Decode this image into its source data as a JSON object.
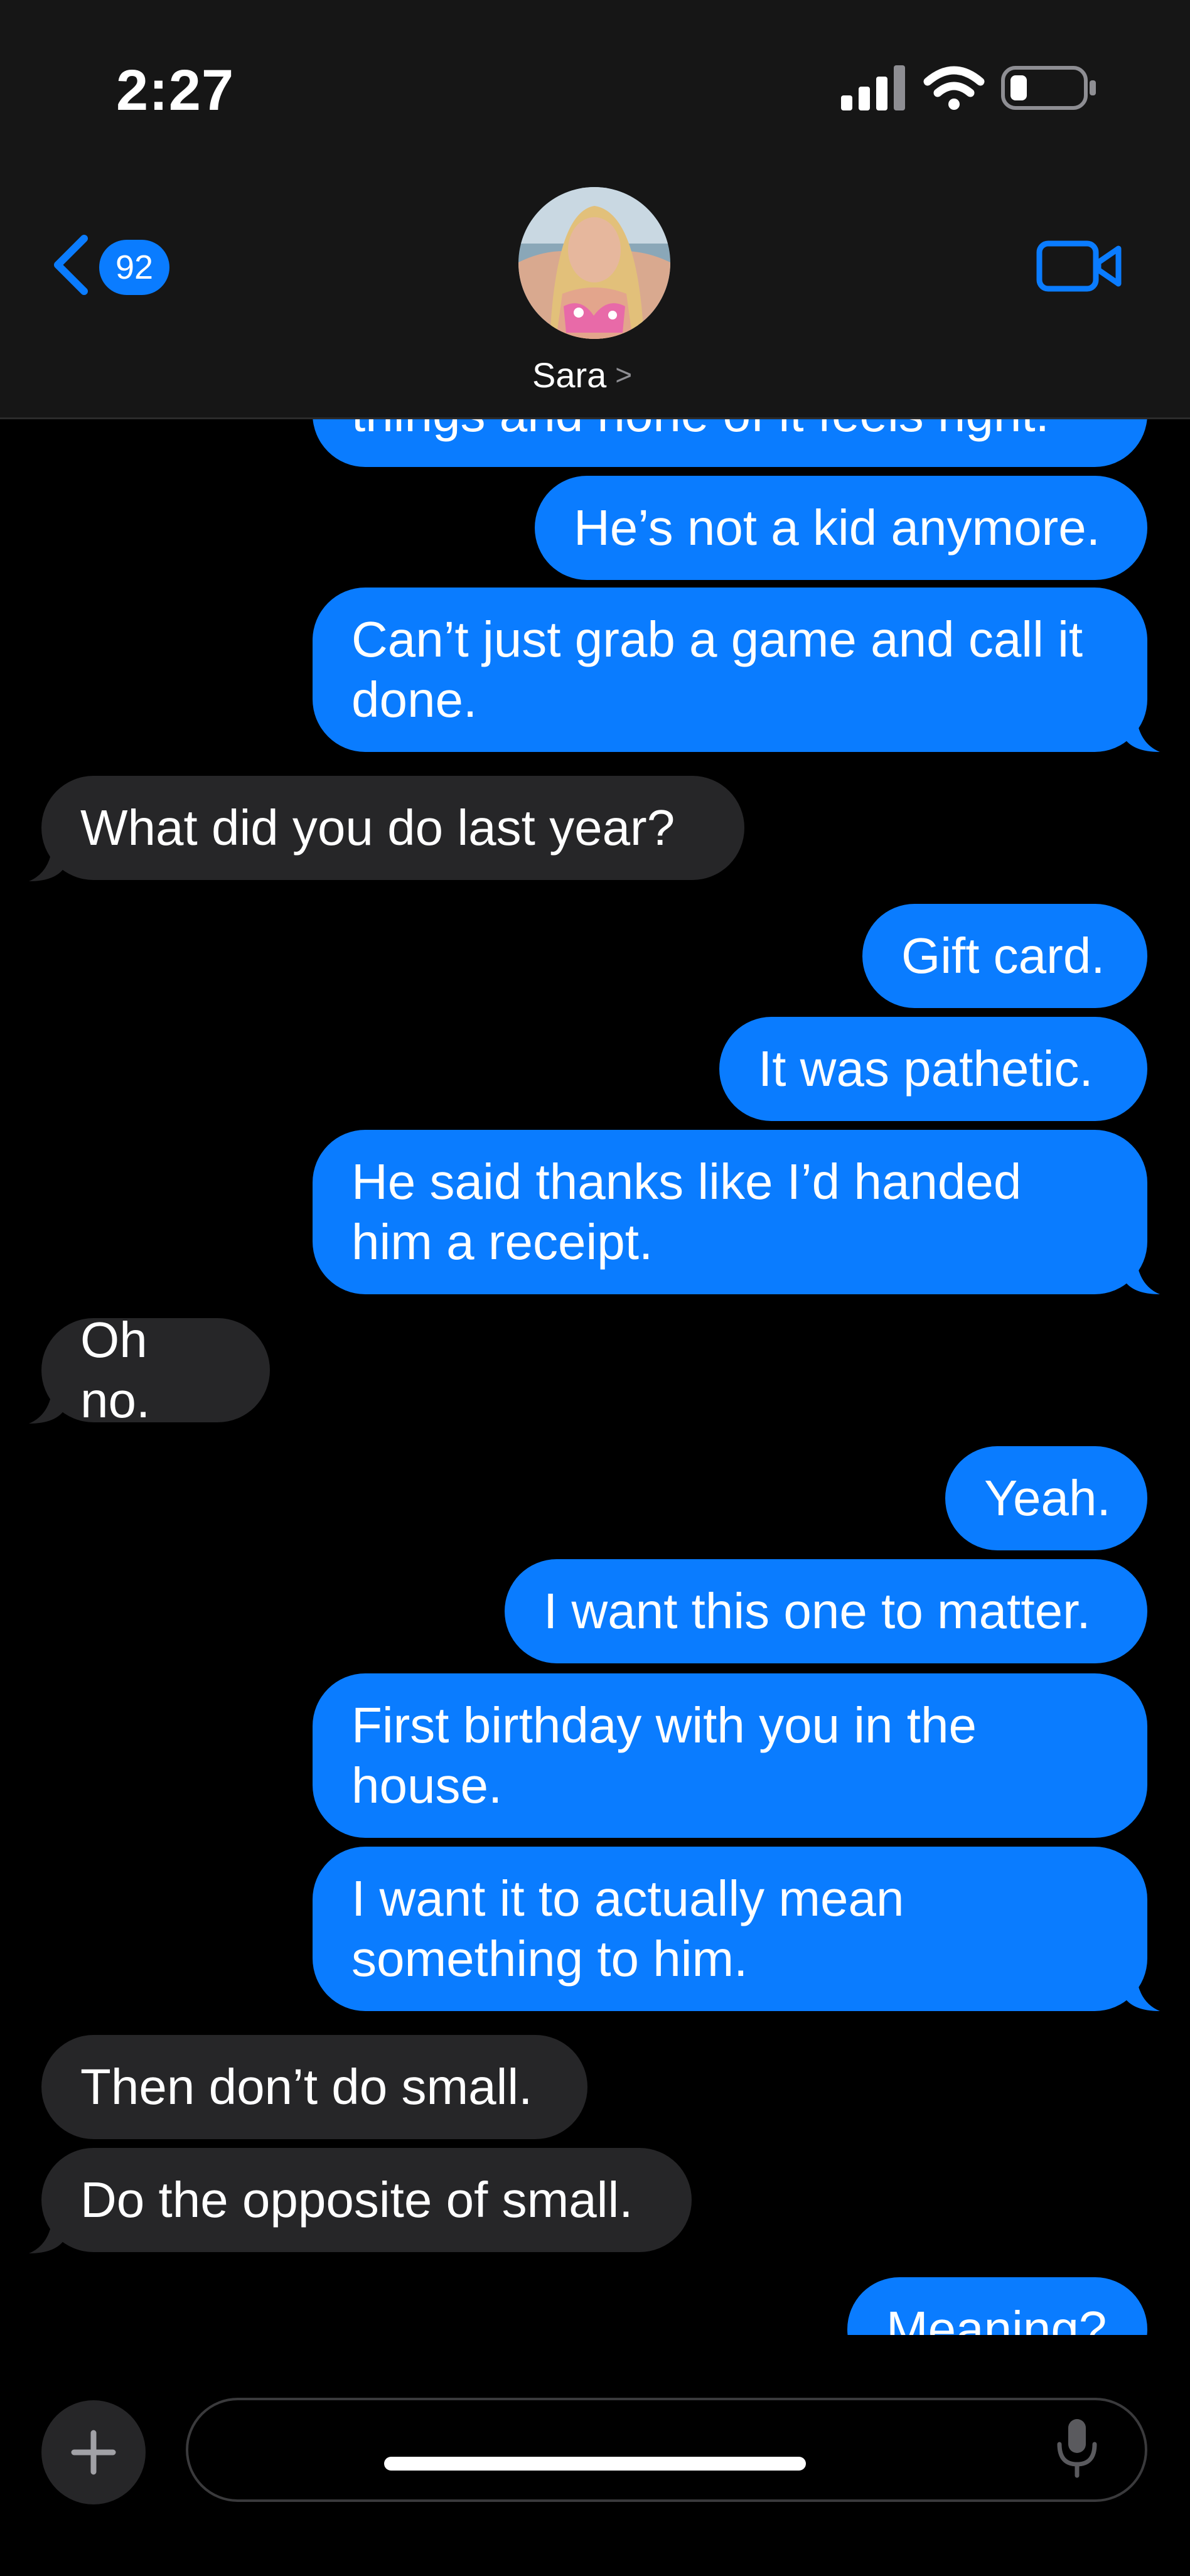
{
  "status_bar": {
    "time": "2:27",
    "icons": [
      "cellular-signal-icon",
      "wifi-icon",
      "battery-icon"
    ]
  },
  "nav": {
    "back_count": "92",
    "contact_name": "Sara",
    "contact_chevron": ">",
    "icons": [
      "back-chevron-icon",
      "video-camera-icon"
    ]
  },
  "colors": {
    "outgoing_bubble": "#0a7cff",
    "incoming_bubble": "#262628",
    "background": "#000000",
    "header_background": "#161616"
  },
  "messages": [
    {
      "from": "me",
      "text": "things and none of it feels right."
    },
    {
      "from": "me",
      "text": "He’s not a kid anymore."
    },
    {
      "from": "me",
      "text": "Can’t just grab a game and call it\ndone."
    },
    {
      "from": "them",
      "text": "What did you do last year?"
    },
    {
      "from": "me",
      "text": "Gift card."
    },
    {
      "from": "me",
      "text": "It was pathetic."
    },
    {
      "from": "me",
      "text": "He said thanks like I’d handed\nhim a receipt."
    },
    {
      "from": "them",
      "text": "Oh no."
    },
    {
      "from": "me",
      "text": "Yeah."
    },
    {
      "from": "me",
      "text": "I want this one to matter."
    },
    {
      "from": "me",
      "text": "First birthday with you in the\nhouse."
    },
    {
      "from": "me",
      "text": "I want it to actually mean\nsomething to him."
    },
    {
      "from": "them",
      "text": "Then don’t do small."
    },
    {
      "from": "them",
      "text": "Do the opposite of small."
    },
    {
      "from": "me",
      "text": "Meaning?"
    }
  ],
  "composer": {
    "placeholder": "",
    "value": "",
    "icons": [
      "plus-icon",
      "microphone-icon"
    ]
  }
}
